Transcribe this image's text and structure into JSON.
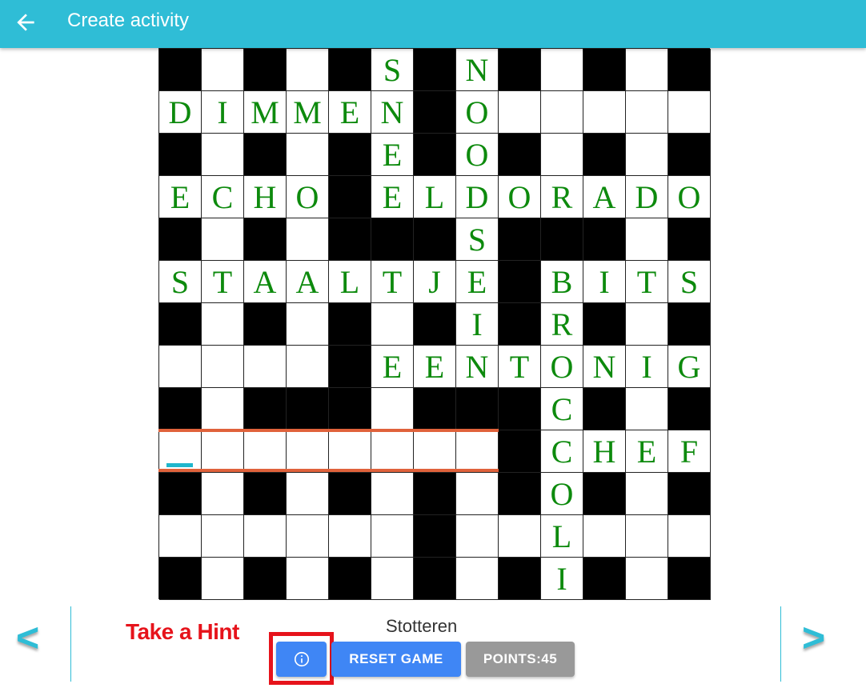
{
  "header": {
    "title": "Create activity",
    "back_icon": "arrow-left-icon"
  },
  "crossword": {
    "rows": [
      "#_#_#S#N#_#_#",
      "DIMMEN#O_____",
      "#_#_#E#O#_#_#",
      "ECHO#ELDORADO",
      "#_#_###S###_#",
      "STAALTJE#BITS",
      "#_#_#_#I#R#_#",
      "____#EENTONIG",
      "#_###_###C#_#",
      "________#CHEF",
      "#_#_#_#_#O#_#",
      "______#__L___",
      "#_#_#_#_#I#_#"
    ],
    "letter_color": "#0d8a0d",
    "highlight_color": "#e0623b",
    "cursor_color": "#1fb6cc"
  },
  "navigation": {
    "prev_label": "<",
    "next_label": ">"
  },
  "clue": {
    "text": "Stotteren"
  },
  "hint": {
    "annotation": "Take a Hint",
    "icon": "info-circle-icon"
  },
  "buttons": {
    "reset_label": "RESET GAME",
    "points_label": "POINTS:45"
  }
}
